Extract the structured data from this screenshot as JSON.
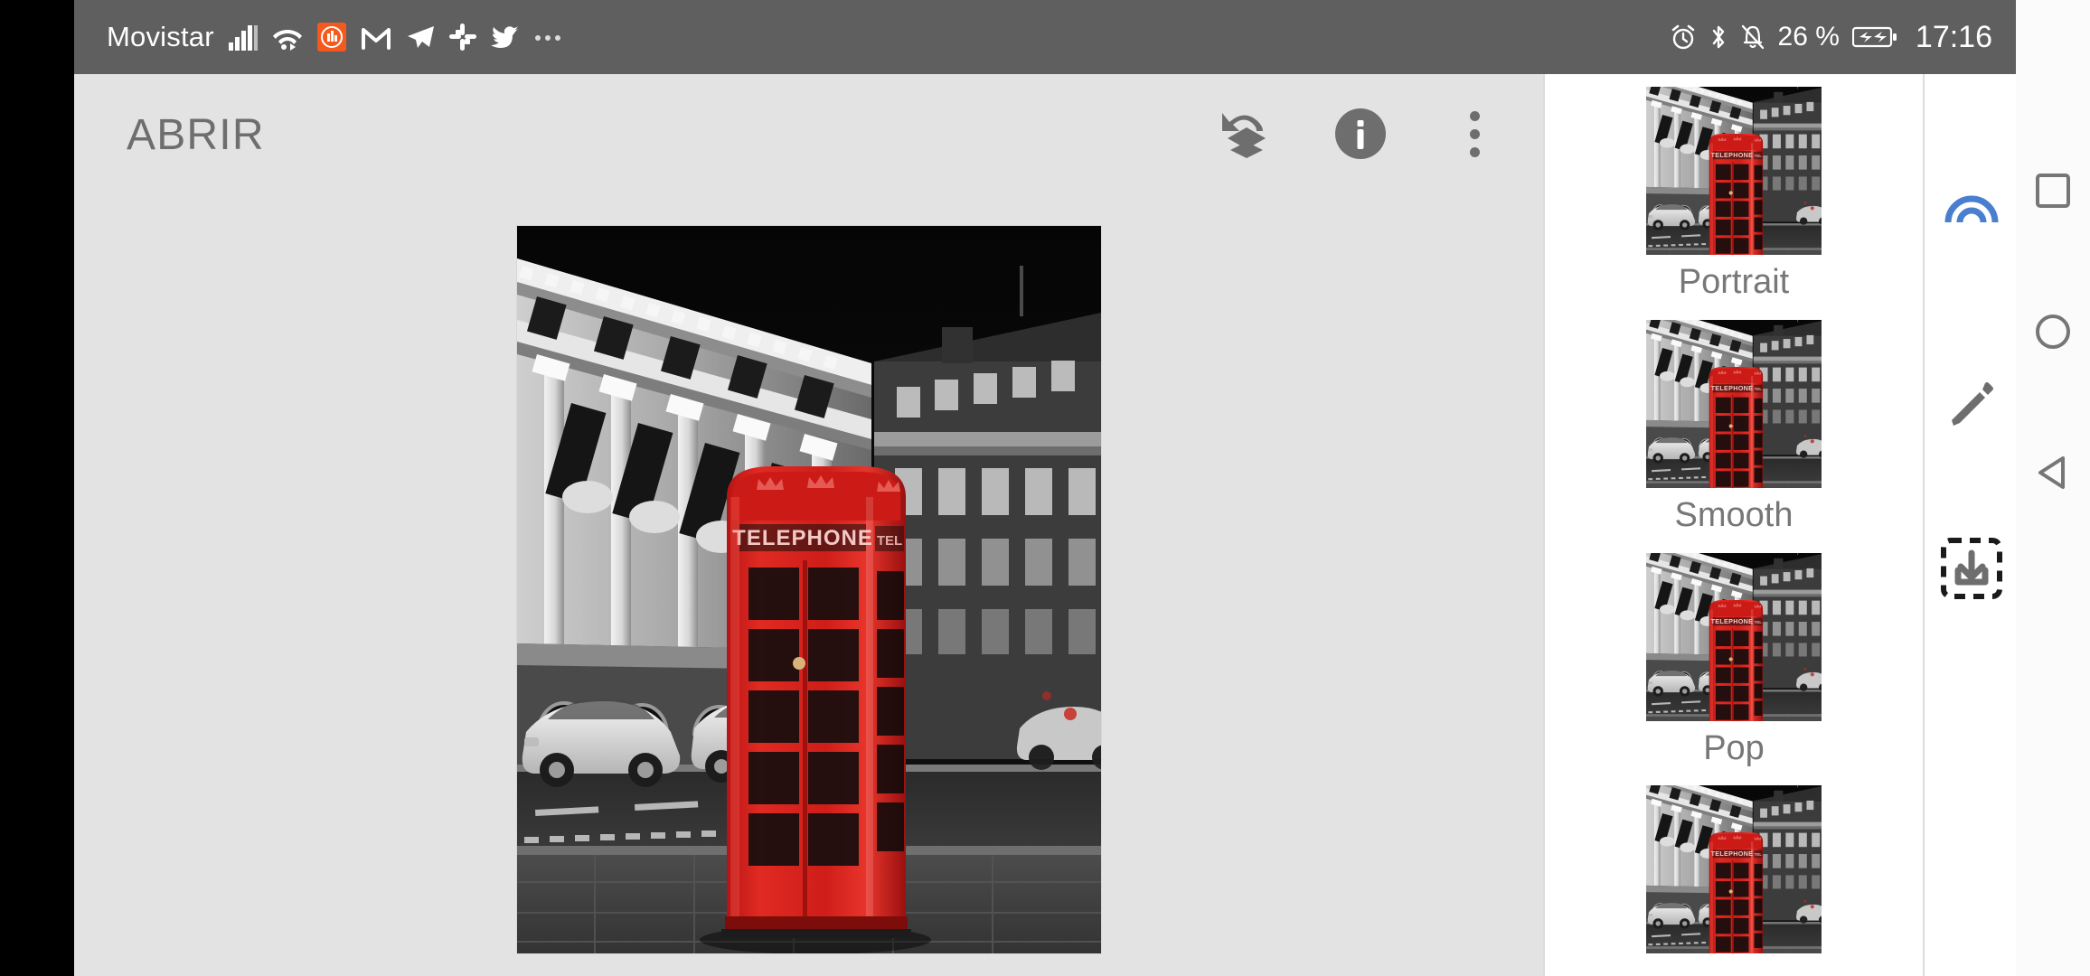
{
  "statusbar": {
    "carrier": "Movistar",
    "battery_percent": "26 %",
    "clock": "17:16",
    "left_icons": [
      "signal-bars-icon",
      "wifi-icon",
      "mi-app-icon",
      "gmail-icon",
      "telegram-icon",
      "slack-icon",
      "twitter-icon",
      "more-notifications-icon"
    ],
    "right_icons": [
      "alarm-clock-icon",
      "bluetooth-icon",
      "bell-muted-icon",
      "battery-charging-icon"
    ]
  },
  "editor": {
    "title": "ABRIR",
    "toolbar": {
      "undo_layers_label": "undo-layers",
      "info_label": "info",
      "overflow_label": "more options"
    },
    "photo": {
      "alt": "Black and white London street at night with a red telephone booth",
      "booth_text": "TELEPHONE",
      "accent_color": "#d42020"
    }
  },
  "filters": {
    "items": [
      {
        "label": "Portrait"
      },
      {
        "label": "Smooth"
      },
      {
        "label": "Pop"
      },
      {
        "label": ""
      }
    ]
  },
  "tools": {
    "effects_label": "effects",
    "edit_label": "edit",
    "save_label": "save",
    "effects_color": "#4a7fd0"
  },
  "navigation": {
    "recents_label": "recents",
    "home_label": "home",
    "back_label": "back"
  }
}
